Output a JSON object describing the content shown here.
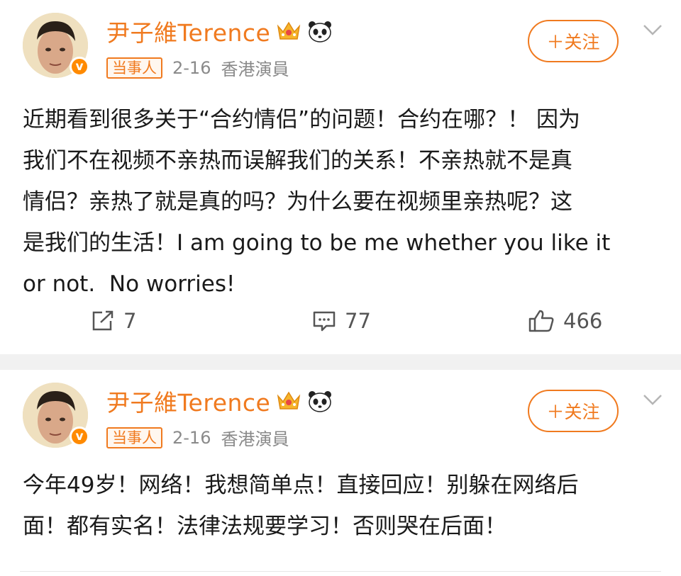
{
  "posts": [
    {
      "author": "尹子維Terence",
      "tag": "当事人",
      "date": "2-16",
      "location": "香港演員",
      "follow_label": "＋关注",
      "content": "近期看到很多关于“合约情侣”的问题！合约在哪？！ 因为\n我们不在视频不亲热而误解我们的关系！不亲热就不是真\n情侣？亲热了就是真的吗？为什么要在视频里亲热呢？这\n是我们的生活！I am going to be me whether you like it\nor not.  No worries!",
      "reposts": "7",
      "comments": "77",
      "likes": "466",
      "verified_mark": "v"
    },
    {
      "author": "尹子維Terence",
      "tag": "当事人",
      "date": "2-16",
      "location": "香港演員",
      "follow_label": "＋关注",
      "content": "今年49岁！网络！我想简单点！直接回应！别躲在网络后\n面！都有实名！法律法规要学习！否则哭在后面！",
      "verified_mark": "v"
    }
  ],
  "icons": {
    "crown": "crown-icon",
    "panda": "panda-icon",
    "repost": "share-icon",
    "comment": "comment-icon",
    "like": "thumbs-up-icon",
    "chevron": "chevron-down-icon"
  },
  "colors": {
    "accent": "#f07a1f",
    "text": "#1a1a1a",
    "muted": "#8a8a8a",
    "separator": "#f1f1f1"
  }
}
